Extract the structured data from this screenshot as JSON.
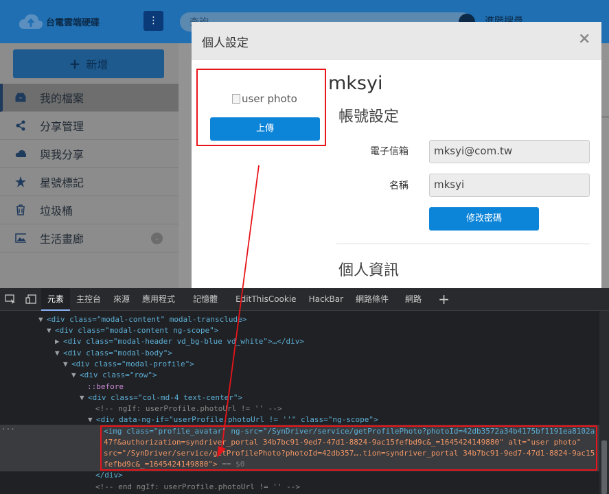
{
  "app": {
    "logo_text": "台電雲端硬碟",
    "search_placeholder": "查詢",
    "advanced_search": "進階搜尋"
  },
  "sidebar": {
    "add_label": "新增",
    "items": [
      {
        "label": "我的檔案",
        "icon": "inbox-icon"
      },
      {
        "label": "分享管理",
        "icon": "share-icon"
      },
      {
        "label": "與我分享",
        "icon": "cloud-icon"
      },
      {
        "label": "星號標記",
        "icon": "star-icon"
      },
      {
        "label": "垃圾桶",
        "icon": "trash-icon"
      },
      {
        "label": "生活畫廊",
        "icon": "image-icon"
      }
    ]
  },
  "modal": {
    "title": "個人設定",
    "close": "×",
    "photo_alt": "user photo",
    "upload_label": "上傳",
    "username": "mksyi",
    "account_heading": "帳號設定",
    "email_label": "電子信箱",
    "email_value": "mksyi@com.tw",
    "name_label": "名稱",
    "name_value": "mksyi",
    "change_password_label": "修改密碼",
    "personal_heading": "個人資訊"
  },
  "devtools": {
    "tabs": [
      "元素",
      "主控台",
      "來源",
      "應用程式",
      "記憶體",
      "EditThisCookie",
      "HackBar",
      "網路條件",
      "網路"
    ],
    "selected_tab": "元素",
    "add_tab": "+"
  },
  "code": {
    "l1": "<div class=\"modal-content\" modal-transclude>",
    "l2": "<div class=\"modal-content ng-scope\">",
    "l3": "<div class=\"modal-header vd_bg-blue vd_white\">…</div>",
    "l4": "<div class=\"modal-body\">",
    "l5": "<div class=\"modal-profile\">",
    "l6": "<div class=\"row\">",
    "l7": "::before",
    "l8": "<div class=\"col-md-4 text-center\">",
    "l9": "<!-- ngIf: userProfile.photoUrl != '' -->",
    "l10": "<div data-ng-if=\"userProfile.photoUrl != ''\" class=\"ng-scope\">",
    "img1": "<img class=\"profile_avatar\" ng-src=\"/SynDriver/service/getProfilePhoto?photoId=42db3572a34b4175bf1191ea8102a",
    "img2": "47f&authorization=syndriver_portal 34b7bc91-9ed7-47d1-8824-9ac15fefbd9c&_=1645424149880\" alt=\"user photo\"",
    "img3": "src=\"/SynDriver/service/getProfilePhoto?photoId=42db357….tion=syndriver_portal 34b7bc91-9ed7-47d1-8824-9ac15",
    "img4": "fefbd9c&_=1645424149880\">",
    "img4_suffix": " == $0",
    "l11": "</div>",
    "l12": "<!-- end ngIf: userProfile.photoUrl != '' -->",
    "ellipsis": "···"
  },
  "colors": {
    "topbar": "#1f6fb2",
    "accent": "#0c84d8",
    "highlight": "#e8141a"
  }
}
